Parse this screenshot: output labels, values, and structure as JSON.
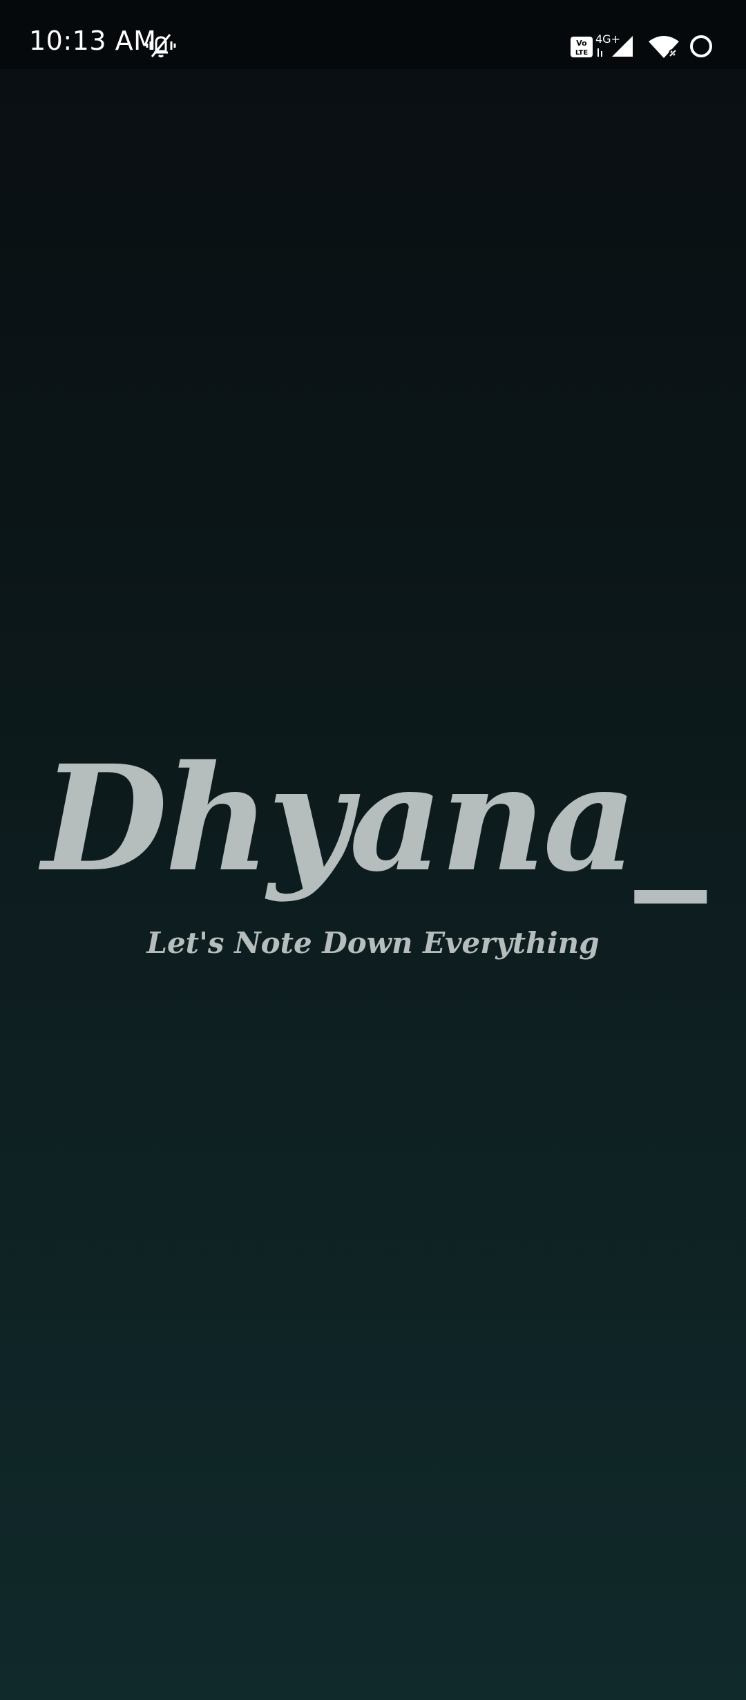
{
  "status_bar": {
    "time": "10:13 AM",
    "network_label": "4G+",
    "volte_label": "Vo LTE",
    "icons": [
      "vibrate-mute-icon",
      "volte-icon",
      "signal-icon",
      "wifi-icon",
      "battery-icon"
    ]
  },
  "splash": {
    "title": "Dhyana_",
    "tagline": "Let's Note Down Everything",
    "text_color": "#b6bdbd",
    "background_top": "#0a0e12",
    "background_bottom": "#10292a"
  }
}
